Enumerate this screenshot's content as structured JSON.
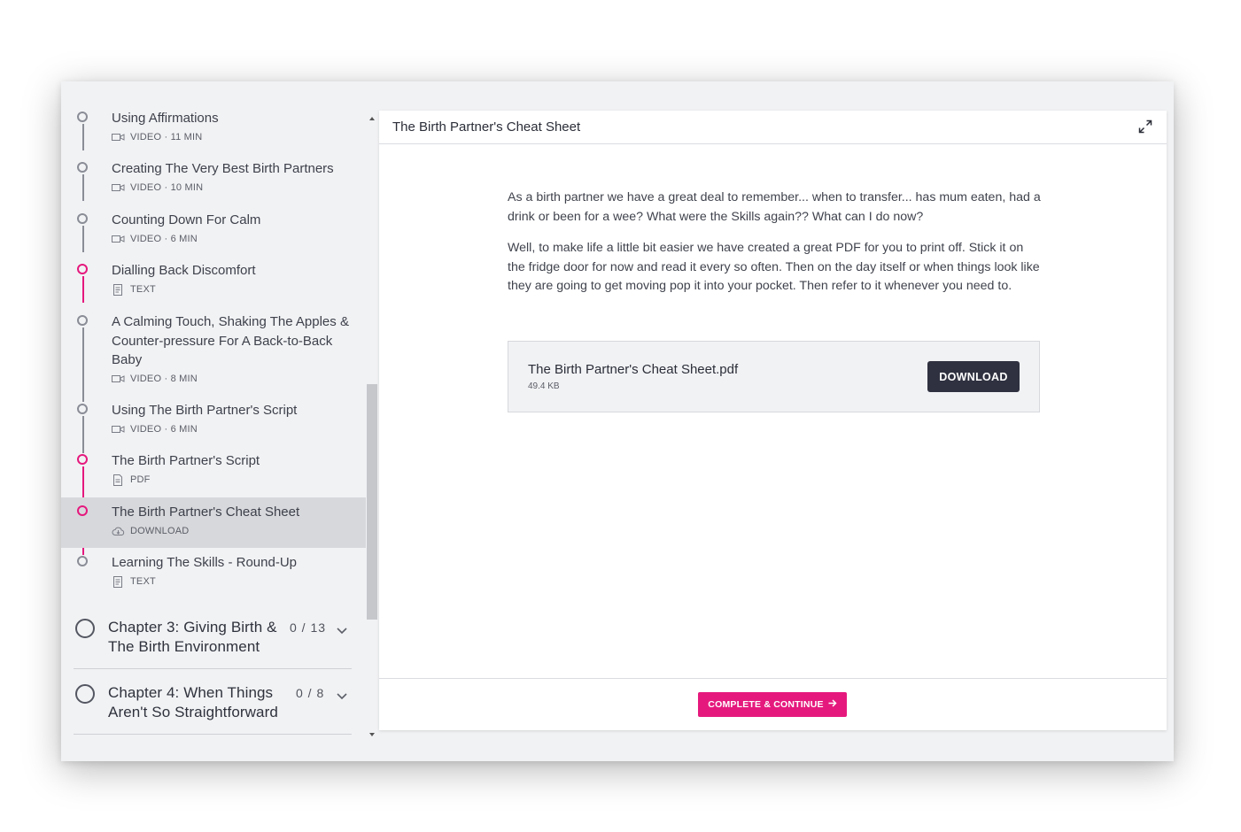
{
  "sidebar": {
    "lessons": [
      {
        "title": "Using Affirmations",
        "meta": "VIDEO · 11 MIN",
        "icon": "video-icon",
        "done": false
      },
      {
        "title": "Creating The Very Best Birth Partners",
        "meta": "VIDEO · 10 MIN",
        "icon": "video-icon",
        "done": false
      },
      {
        "title": "Counting Down For Calm",
        "meta": "VIDEO · 6 MIN",
        "icon": "video-icon",
        "done": false
      },
      {
        "title": "Dialling Back Discomfort",
        "meta": "TEXT",
        "icon": "text-doc-icon",
        "done": true
      },
      {
        "title": "A Calming Touch, Shaking The Apples & Counter-pressure For A Back-to-Back Baby",
        "meta": "VIDEO · 8 MIN",
        "icon": "video-icon",
        "done": false
      },
      {
        "title": "Using The Birth Partner's Script",
        "meta": "VIDEO · 6 MIN",
        "icon": "video-icon",
        "done": false
      },
      {
        "title": "The Birth Partner's Script",
        "meta": "PDF",
        "icon": "pdf-icon",
        "done": true
      },
      {
        "title": "The Birth Partner's Cheat Sheet",
        "meta": "DOWNLOAD",
        "icon": "cloud-download-icon",
        "done": true,
        "active": true
      },
      {
        "title": "Learning The Skills - Round-Up",
        "meta": "TEXT",
        "icon": "text-doc-icon",
        "done": false
      }
    ],
    "chapters": [
      {
        "title": "Chapter 3: Giving Birth & The Birth Environment",
        "count": "0 / 13"
      },
      {
        "title": "Chapter 4: When Things Aren't So Straightforward",
        "count": "0 / 8"
      }
    ]
  },
  "content": {
    "title": "The Birth Partner's Cheat Sheet",
    "paragraphs": [
      "As a birth partner we have a great deal to remember... when to transfer... has mum eaten, had a drink or been for a wee? What were the Skills again?? What can I do now?",
      "Well, to make life a little bit easier we have created a great PDF for you to print off. Stick it on the fridge door for now and read it every so often. Then on the day itself or when things look like they are going to get moving pop it into your pocket. Then refer to it whenever you need to."
    ],
    "file": {
      "name": "The Birth Partner's Cheat Sheet.pdf",
      "size": "49.4 KB",
      "button": "DOWNLOAD"
    },
    "footer_button": "COMPLETE & CONTINUE"
  },
  "colors": {
    "accent": "#e5197d",
    "dark_button": "#2f3140"
  }
}
